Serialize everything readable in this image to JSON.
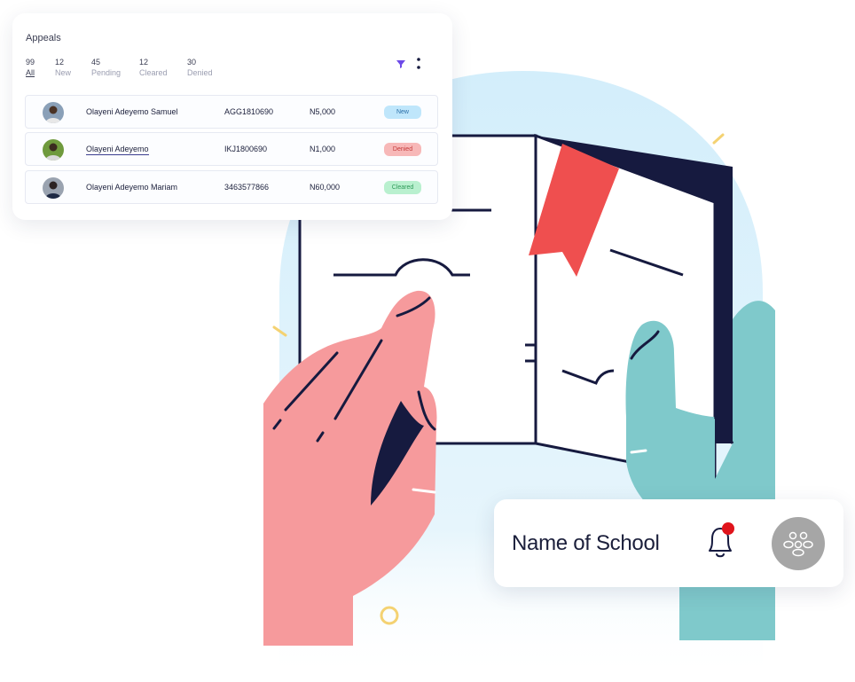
{
  "appeals": {
    "title": "Appeals",
    "stats": [
      {
        "count": "99",
        "label": "All"
      },
      {
        "count": "12",
        "label": "New"
      },
      {
        "count": "45",
        "label": "Pending"
      },
      {
        "count": "12",
        "label": "Cleared"
      },
      {
        "count": "30",
        "label": "Denied"
      }
    ],
    "filter_icon": "filter-icon",
    "more_icon": "more-vertical-icon",
    "rows": [
      {
        "name": "Olayeni Adeyemo Samuel",
        "code": "AGG1810690",
        "amount": "N5,000",
        "status": "New"
      },
      {
        "name": "Olayeni Adeyemo",
        "code": "IKJ1800690",
        "amount": "N1,000",
        "status": "Denied"
      },
      {
        "name": "Olayeni Adeyemo Mariam",
        "code": "3463577866",
        "amount": "N60,000",
        "status": "Cleared"
      }
    ]
  },
  "school_card": {
    "name": "Name of School",
    "bell_icon": "bell-icon",
    "notification_dot": true,
    "avatar_icon": "group-icon"
  },
  "colors": {
    "accent": "#6d4ae8",
    "navy": "#161a3f",
    "hand_pink": "#f69a9c",
    "hand_teal": "#7fc9cb",
    "bookmark_red": "#ef4f4f",
    "blob_blue": "#d3eefb",
    "new_badge": "#bfe6fb",
    "denied_badge": "#f7b8b8",
    "cleared_badge": "#b9f0cf",
    "notification_red": "#e0141b"
  }
}
